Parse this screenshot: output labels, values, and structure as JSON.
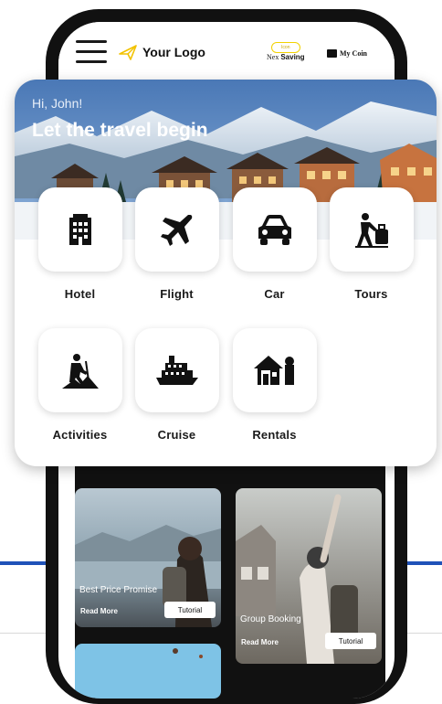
{
  "header": {
    "logo_text": "Your Logo",
    "nex_badge": "Icon",
    "nex_prefix": "Nex",
    "nex_label": "Saving",
    "coin_label": "My Coin"
  },
  "hero": {
    "greeting": "Hi, John!",
    "tagline": "Let the travel begin"
  },
  "services": [
    {
      "label": "Hotel",
      "icon": "hotel-icon"
    },
    {
      "label": "Flight",
      "icon": "flight-icon"
    },
    {
      "label": "Car",
      "icon": "car-icon"
    },
    {
      "label": "Tours",
      "icon": "tours-icon"
    },
    {
      "label": "Activities",
      "icon": "activities-icon"
    },
    {
      "label": "Cruise",
      "icon": "cruise-icon"
    },
    {
      "label": "Rentals",
      "icon": "rentals-icon"
    }
  ],
  "promos": [
    {
      "title": "Best Price Promise",
      "read_more": "Read More",
      "button": "Tutorial"
    },
    {
      "title": "Group Booking",
      "read_more": "Read More",
      "button": "Tutorial"
    }
  ],
  "colors": {
    "accent_blue": "#1f52b8",
    "logo_yellow": "#f2c200"
  }
}
